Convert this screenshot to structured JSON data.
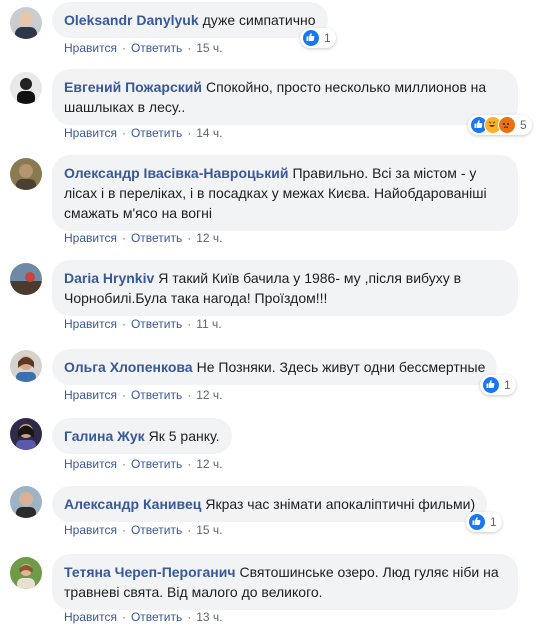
{
  "labels": {
    "like": "Нравится",
    "reply": "Ответить",
    "dot": "·"
  },
  "colors": {
    "author": "#385898",
    "bubble": "#f2f3f5",
    "meta": "#606770",
    "like": "#1877f2"
  },
  "comments": [
    {
      "author": "Oleksandr Danylyuk",
      "text": "дуже симпатично",
      "time": "15 ч.",
      "reactions": [
        "like-reaction-icon"
      ],
      "count": "1"
    },
    {
      "author": "Евгений Пожарский",
      "text": "Спокойно, просто несколько миллионов на шашлыках в лесу..",
      "time": "14 ч.",
      "reactions": [
        "like-reaction-icon",
        "haha-reaction-icon",
        "angry-reaction-icon"
      ],
      "count": "5"
    },
    {
      "author": "Олександр Івасівка-Навроцький",
      "text": "Правильно. Всі за містом - у лісах і в переліках, і в посадках у межах Києва. Найобдарованіші смажать м'ясо на вогні",
      "time": "12 ч.",
      "reactions": [],
      "count": ""
    },
    {
      "author": "Daria Hrynkiv",
      "text": "Я такий Київ бачила у 1986- му ,після вибуху в Чорнобилі.Була така нагода! Проїздом!!!",
      "time": "11 ч.",
      "reactions": [],
      "count": ""
    },
    {
      "author": "Ольга Хлопенкова",
      "text": "Не Позняки. Здесь живут одни бессмертные",
      "time": "12 ч.",
      "reactions": [
        "like-reaction-icon"
      ],
      "count": "1"
    },
    {
      "author": "Галина Жук",
      "text": "Як 5 ранку.",
      "time": "12 ч.",
      "reactions": [],
      "count": ""
    },
    {
      "author": "Александр Канивец",
      "text": "Якраз час знімати апокаліптичні фильми)",
      "time": "15 ч.",
      "reactions": [
        "like-reaction-icon"
      ],
      "count": "1"
    },
    {
      "author": "Тетяна Череп-Пероганич",
      "text": "Святошинське озеро. Люд гуляє ніби на травневі свята. Від малого до великого.",
      "time": "13 ч.",
      "reactions": [],
      "count": ""
    }
  ]
}
